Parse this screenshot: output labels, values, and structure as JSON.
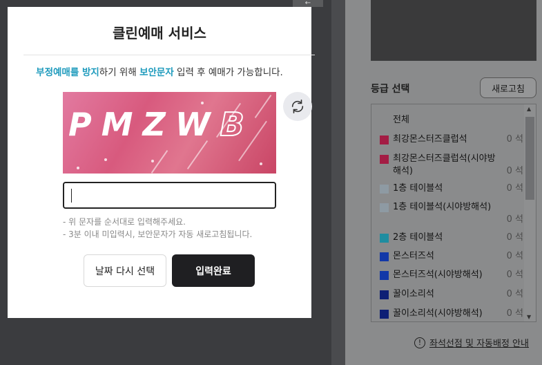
{
  "modal": {
    "title": "클린예매 서비스",
    "instruction": {
      "part1": "부정예매를 방지",
      "part2": "하기 위해 ",
      "part3": "보안문자",
      "part4": " 입력 후 예매가 가능합니다."
    },
    "captcha_text": "PMZW",
    "captcha_last": "B",
    "input_value": "",
    "notes": [
      "- 위 문자를 순서대로 입력해주세요.",
      "- 3분 이내 미입력시, 보안문자가 자동 새로고침됩니다."
    ],
    "buttons": {
      "back": "날짜 다시 선택",
      "submit": "입력완료"
    },
    "highlight_color": "#1f9bbd"
  },
  "side_panel": {
    "grade_title": "등급 선택",
    "refresh_label": "새로고침",
    "grades": [
      {
        "name": "전체",
        "count": "",
        "color": ""
      },
      {
        "name": "최강몬스터즈클럽석",
        "count": "0 석",
        "color": "#a31d44"
      },
      {
        "name": "최강몬스터즈클럽석(시야방해석)",
        "count": "0 석",
        "color": "#a31d44"
      },
      {
        "name": "1층 테이블석",
        "count": "0 석",
        "color": "#8e9aa3"
      },
      {
        "name": "1층 테이블석(시야방해석)",
        "count": "0 석",
        "color": "#8e9aa3"
      },
      {
        "name": "2층 테이블석",
        "count": "0 석",
        "color": "#1f8da0"
      },
      {
        "name": "몬스터즈석",
        "count": "0 석",
        "color": "#1238a8"
      },
      {
        "name": "몬스터즈석(시야방해석)",
        "count": "0 석",
        "color": "#1238a8"
      },
      {
        "name": "꿀이소리석",
        "count": "0 석",
        "color": "#0d1f75"
      },
      {
        "name": "꿀이소리석(시야방해석)",
        "count": "0 석",
        "color": "#0d1f75"
      }
    ],
    "help_text": "좌석선점 및 자동배정 안내"
  }
}
